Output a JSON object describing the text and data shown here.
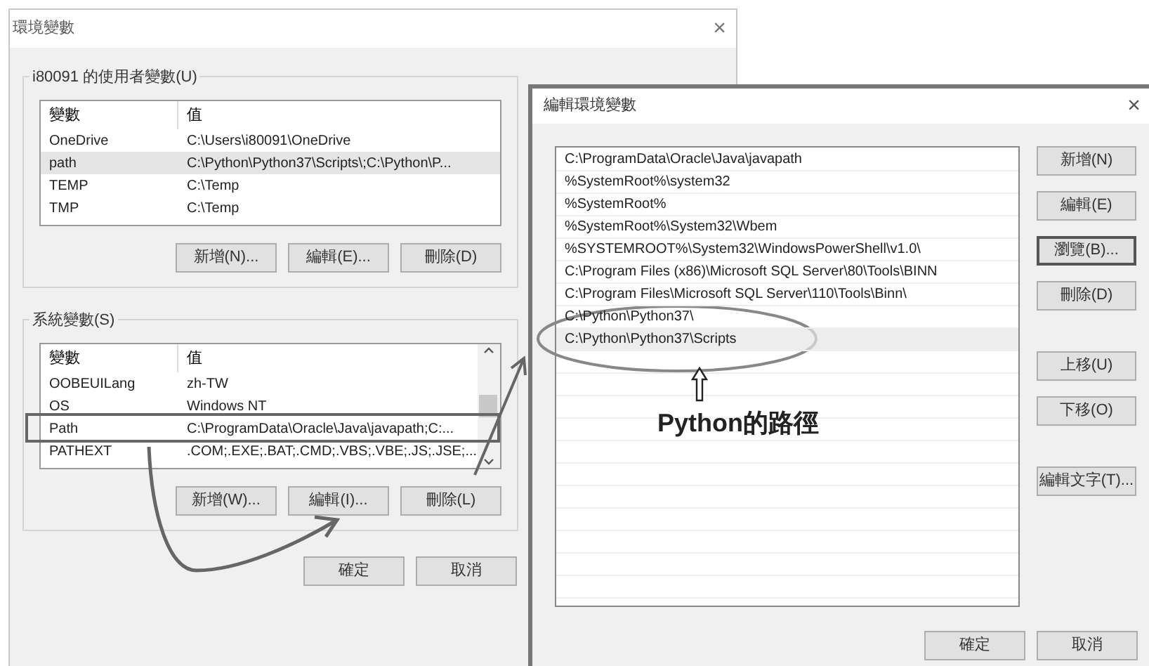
{
  "env_window": {
    "title": "環境變數",
    "close": "×",
    "user_group": {
      "label": "i80091 的使用者變數(U)",
      "columns": [
        "變數",
        "值"
      ],
      "rows": [
        {
          "name": "OneDrive",
          "value": "C:\\Users\\i80091\\OneDrive",
          "selected": false
        },
        {
          "name": "path",
          "value": "C:\\Python\\Python37\\Scripts\\;C:\\Python\\P...",
          "selected": true
        },
        {
          "name": "TEMP",
          "value": "C:\\Temp",
          "selected": false
        },
        {
          "name": "TMP",
          "value": "C:\\Temp",
          "selected": false
        }
      ],
      "buttons": [
        "新增(N)...",
        "編輯(E)...",
        "刪除(D)"
      ]
    },
    "system_group": {
      "label": "系統變數(S)",
      "columns": [
        "變數",
        "值"
      ],
      "rows": [
        {
          "name": "OOBEUILang",
          "value": "zh-TW",
          "selected": false
        },
        {
          "name": "OS",
          "value": "Windows NT",
          "selected": false
        },
        {
          "name": "Path",
          "value": "C:\\ProgramData\\Oracle\\Java\\javapath;C:...",
          "selected": false
        },
        {
          "name": "PATHEXT",
          "value": ".COM;.EXE;.BAT;.CMD;.VBS;.VBE;.JS;.JSE;...",
          "selected": false
        }
      ],
      "buttons": [
        "新增(W)...",
        "編輯(I)...",
        "刪除(L)"
      ]
    },
    "footer_buttons": [
      "確定",
      "取消"
    ]
  },
  "edit_window": {
    "title": "編輯環境變數",
    "close": "×",
    "paths": [
      {
        "text": "C:\\ProgramData\\Oracle\\Java\\javapath",
        "selected": false
      },
      {
        "text": "%SystemRoot%\\system32",
        "selected": false
      },
      {
        "text": "%SystemRoot%",
        "selected": false
      },
      {
        "text": "%SystemRoot%\\System32\\Wbem",
        "selected": false
      },
      {
        "text": "%SYSTEMROOT%\\System32\\WindowsPowerShell\\v1.0\\",
        "selected": false
      },
      {
        "text": "C:\\Program Files (x86)\\Microsoft SQL Server\\80\\Tools\\BINN",
        "selected": false
      },
      {
        "text": "C:\\Program Files\\Microsoft SQL Server\\110\\Tools\\Binn\\",
        "selected": false
      },
      {
        "text": "C:\\Python\\Python37\\",
        "selected": false
      },
      {
        "text": "C:\\Python\\Python37\\Scripts",
        "selected": true
      }
    ],
    "button_groups": [
      [
        {
          "label": "新增(N)",
          "focused": false
        },
        {
          "label": "編輯(E)",
          "focused": false
        },
        {
          "label": "瀏覽(B)...",
          "focused": true
        },
        {
          "label": "刪除(D)",
          "focused": false
        }
      ],
      [
        {
          "label": "上移(U)",
          "focused": false
        },
        {
          "label": "下移(O)",
          "focused": false
        }
      ],
      [
        {
          "label": "編輯文字(T)...",
          "focused": false
        }
      ]
    ],
    "footer_buttons": [
      "確定",
      "取消"
    ]
  },
  "annotation": {
    "label": "Python的路徑"
  }
}
